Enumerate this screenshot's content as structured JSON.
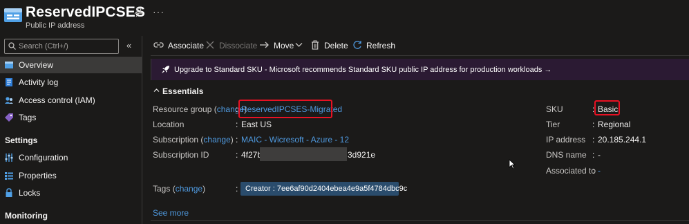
{
  "header": {
    "title": "ReservedIPCSES",
    "subtitle": "Public IP address",
    "more": "···"
  },
  "sidebar": {
    "search_placeholder": "Search (Ctrl+/)",
    "collapse": "«",
    "items": [
      {
        "label": "Overview",
        "icon": "overview-icon"
      },
      {
        "label": "Activity log",
        "icon": "activity-log-icon"
      },
      {
        "label": "Access control (IAM)",
        "icon": "iam-icon"
      },
      {
        "label": "Tags",
        "icon": "tag-icon"
      }
    ],
    "settings_title": "Settings",
    "settings_items": [
      {
        "label": "Configuration",
        "icon": "configuration-icon"
      },
      {
        "label": "Properties",
        "icon": "properties-icon"
      },
      {
        "label": "Locks",
        "icon": "lock-icon"
      }
    ],
    "monitoring_title": "Monitoring"
  },
  "toolbar": {
    "associate": "Associate",
    "dissociate": "Dissociate",
    "move": "Move",
    "delete": "Delete",
    "refresh": "Refresh"
  },
  "banner": {
    "text": "Upgrade to Standard SKU - Microsoft recommends Standard SKU public IP address for production workloads  →"
  },
  "essentials": {
    "title": "Essentials",
    "left": {
      "resource_group_label": "Resource group",
      "change_label": "change",
      "resource_group_value": "ReservedIPCSES-Migrated",
      "location_label": "Location",
      "location_value": "East US",
      "subscription_label": "Subscription",
      "subscription_value": "MAIC - Wicresoft - Azure - 12",
      "subscription_id_label": "Subscription ID",
      "subscription_id_prefix": "4f27b",
      "subscription_id_suffix": "3d921e",
      "tags_label": "Tags",
      "tag_value": "Creator : 7ee6af90d2404ebea4e9a5f4784dbc9c"
    },
    "right": {
      "sku_label": "SKU",
      "sku_value": "Basic",
      "tier_label": "Tier",
      "tier_value": "Regional",
      "ip_label": "IP address",
      "ip_value": "20.185.244.1",
      "dns_label": "DNS name",
      "dns_value": "-",
      "associated_label": "Associated to",
      "associated_value": "-"
    },
    "see_more": "See more"
  },
  "colors": {
    "background": "#1b1a19",
    "link": "#4f9ae0",
    "highlight": "#e81123",
    "banner": "#2b1a33",
    "tag_chip": "#2a4c6c"
  }
}
